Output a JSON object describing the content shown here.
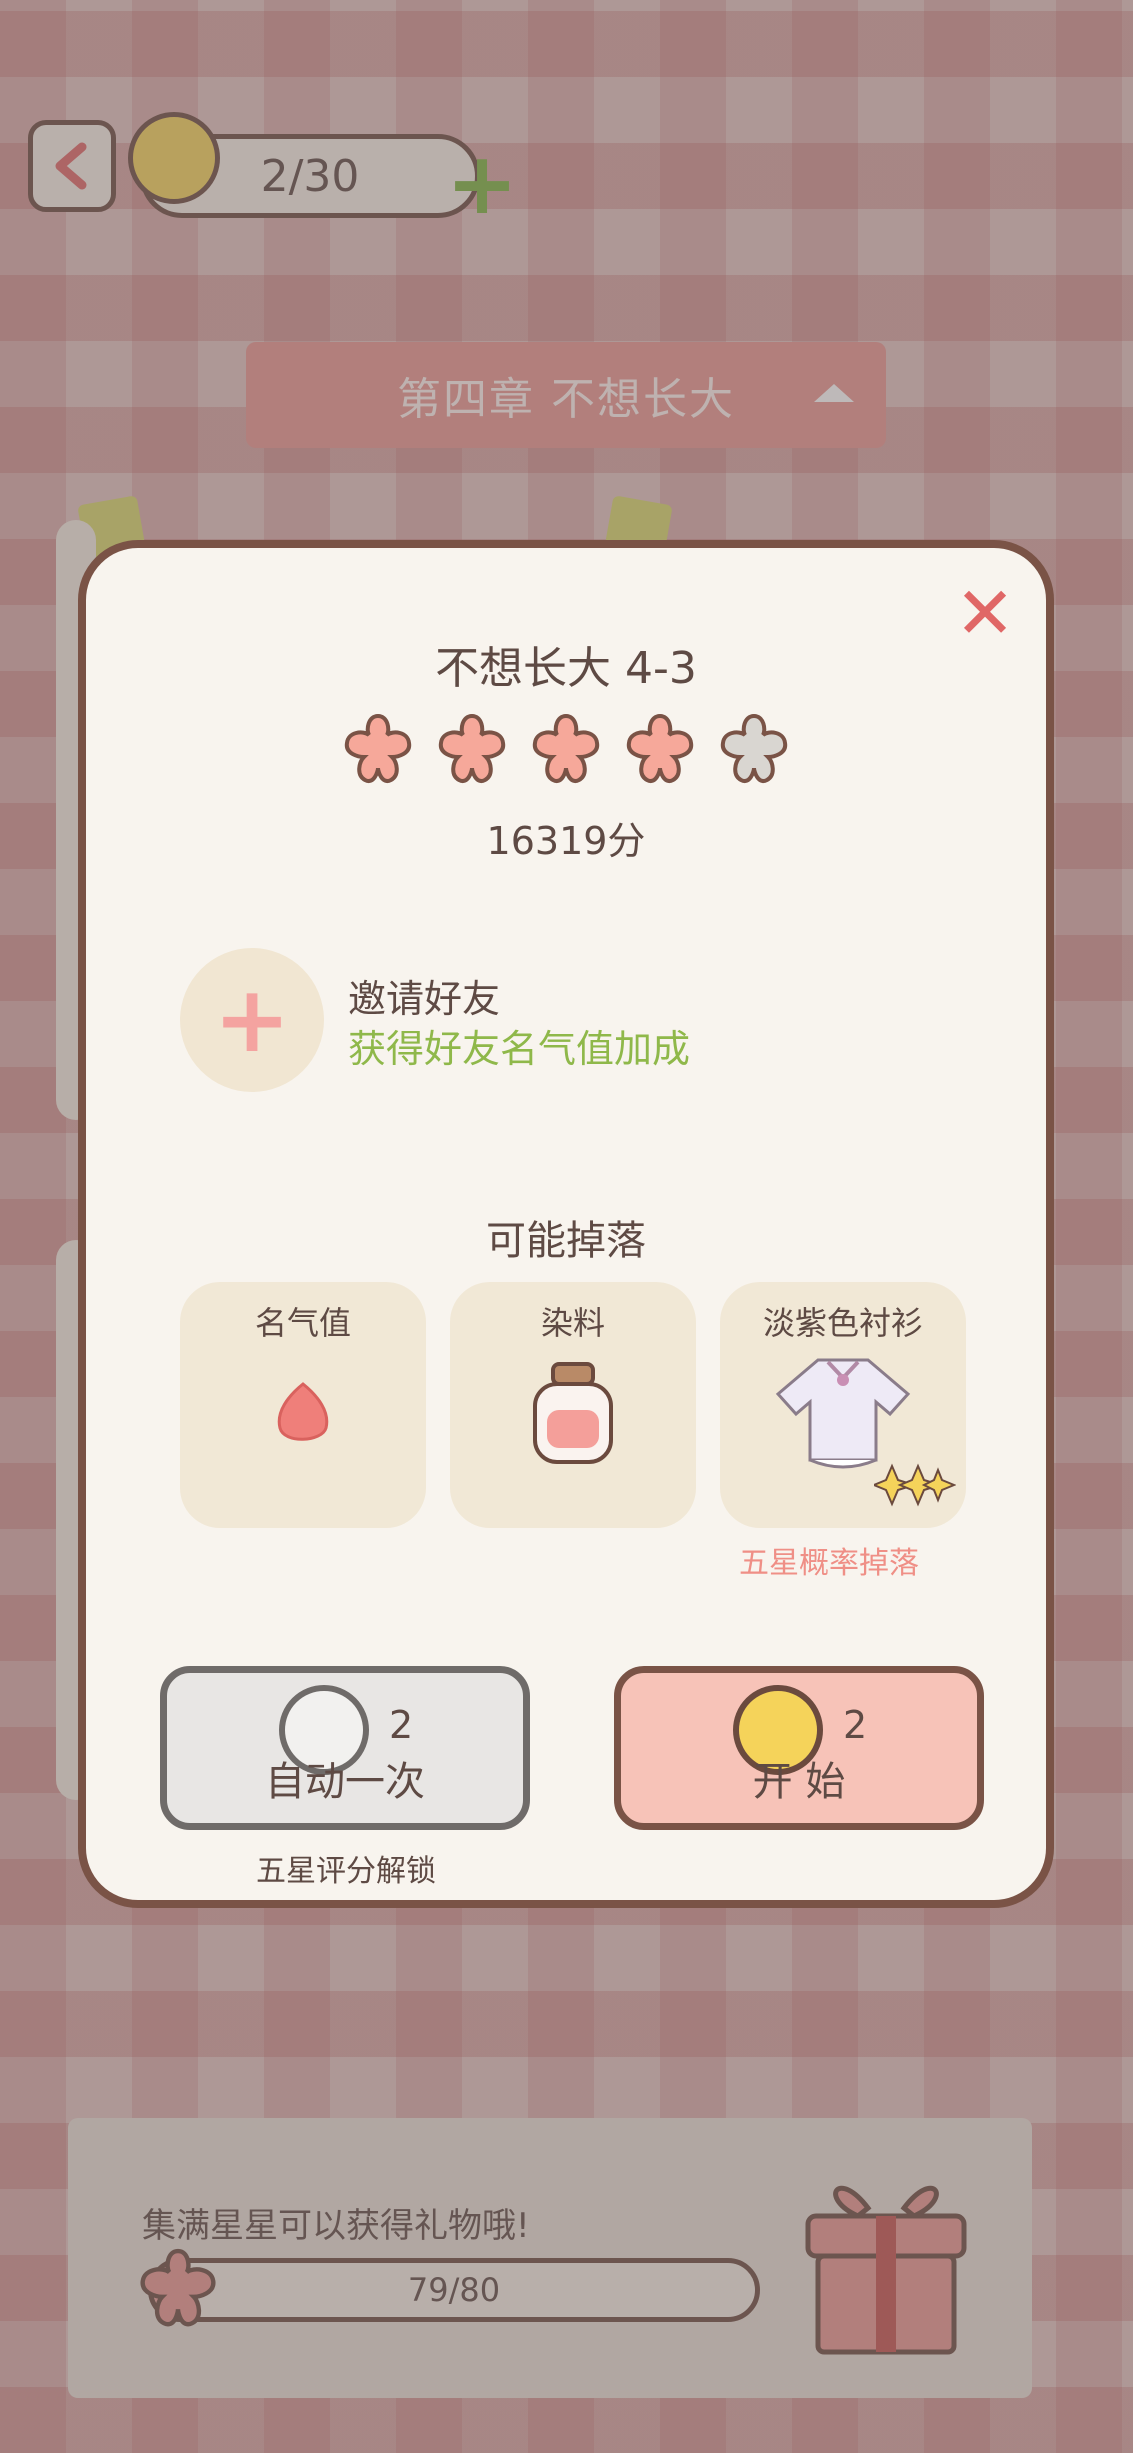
{
  "topbar": {
    "coins": "2/30"
  },
  "chapter": {
    "title": "第四章  不想长大"
  },
  "modal": {
    "level_title": "不想长大 4-3",
    "stars_earned": 4,
    "stars_total": 5,
    "score": "16319分",
    "invite": {
      "title": "邀请好友",
      "subtitle": "获得好友名气值加成"
    },
    "drops": {
      "title": "可能掉落",
      "items": [
        {
          "label": "名气值",
          "icon": "petal-icon"
        },
        {
          "label": "染料",
          "icon": "dye-jar-icon"
        },
        {
          "label": "淡紫色衬衫",
          "icon": "shirt-icon"
        }
      ],
      "five_star_note": "五星概率掉落"
    },
    "auto_button": {
      "label": "自动一次",
      "cost": "2",
      "note": "五星评分解锁"
    },
    "start_button": {
      "label": "开 始",
      "cost": "2"
    }
  },
  "gift": {
    "text": "集满星星可以获得礼物哦!",
    "progress_text": "79/80",
    "progress_fraction": 0.06
  },
  "colors": {
    "star_filled": "#f6a89a",
    "star_empty": "#d9d6d1",
    "accent_green": "#8fb84a",
    "close_red": "#e06766"
  }
}
